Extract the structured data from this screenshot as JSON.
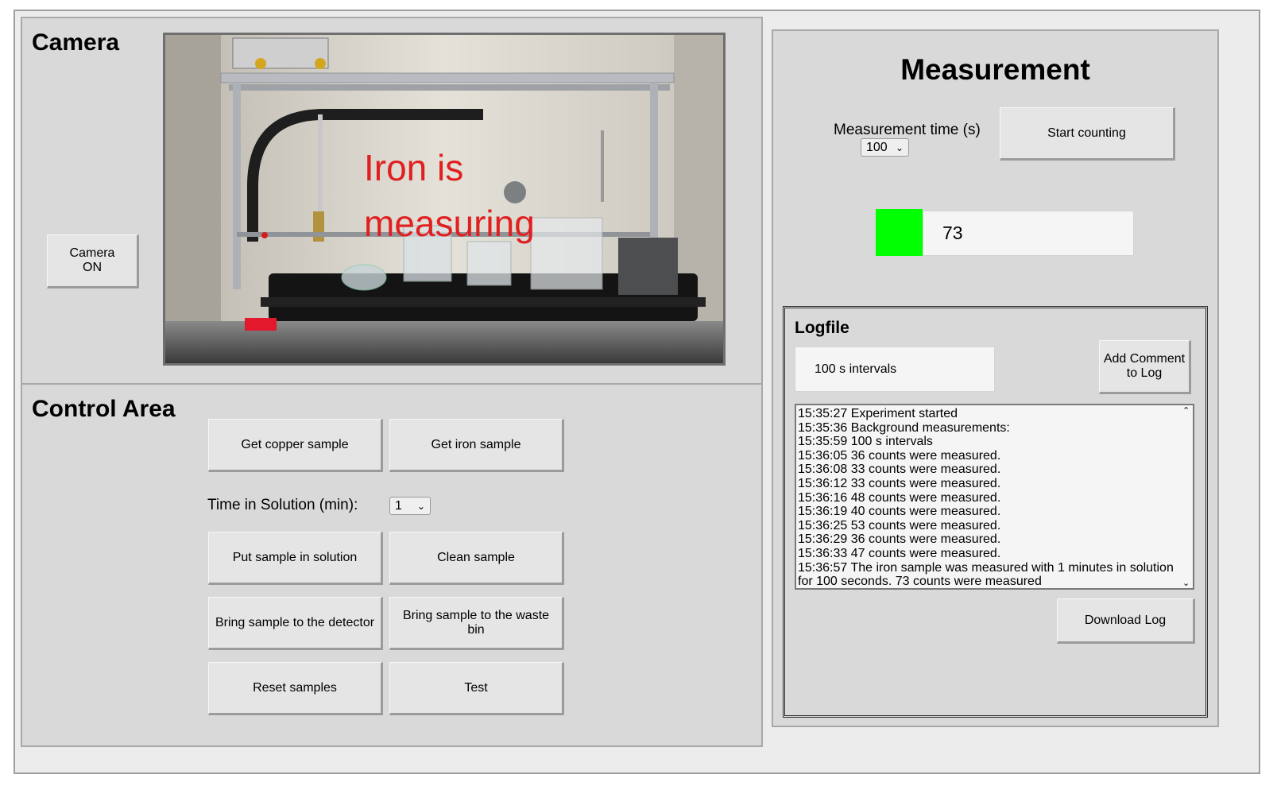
{
  "camera": {
    "title": "Camera",
    "toggle_button": "Camera ON",
    "overlay_line1": "Iron is",
    "overlay_line2": "measuring"
  },
  "control": {
    "title": "Control Area",
    "get_copper": "Get copper sample",
    "get_iron": "Get iron sample",
    "time_label": "Time in Solution (min):",
    "time_value": "1",
    "put_in_solution": "Put sample in solution",
    "clean_sample": "Clean sample",
    "to_detector": "Bring sample to the detector",
    "to_waste": "Bring sample to the waste bin",
    "reset": "Reset samples",
    "test": "Test"
  },
  "measurement": {
    "title": "Measurement",
    "time_label": "Measurement time (s)",
    "time_value": "100",
    "start_button": "Start counting",
    "indicator_color": "#00ff00",
    "count": "73"
  },
  "logfile": {
    "title": "Logfile",
    "interval_text": "100 s intervals",
    "add_comment": "Add Comment to Log",
    "download": "Download Log",
    "entries": [
      "15:35:27 Experiment started",
      "15:35:36 Background measurements:",
      "15:35:59 100 s intervals",
      "15:36:05 36 counts were measured.",
      "15:36:08 33 counts were measured.",
      "15:36:12 33 counts were measured.",
      "15:36:16 48 counts were measured.",
      "15:36:19 40 counts were measured.",
      "15:36:25 53 counts were measured.",
      "15:36:29 36 counts were measured.",
      "15:36:33 47 counts were measured.",
      "15:36:57 The iron sample was measured with 1 minutes in solution for 100 seconds. 73 counts were measured"
    ]
  },
  "colors": {
    "panel": "#d9d9d9",
    "button": "#e5e5e5",
    "overlay_text": "#e02020"
  }
}
